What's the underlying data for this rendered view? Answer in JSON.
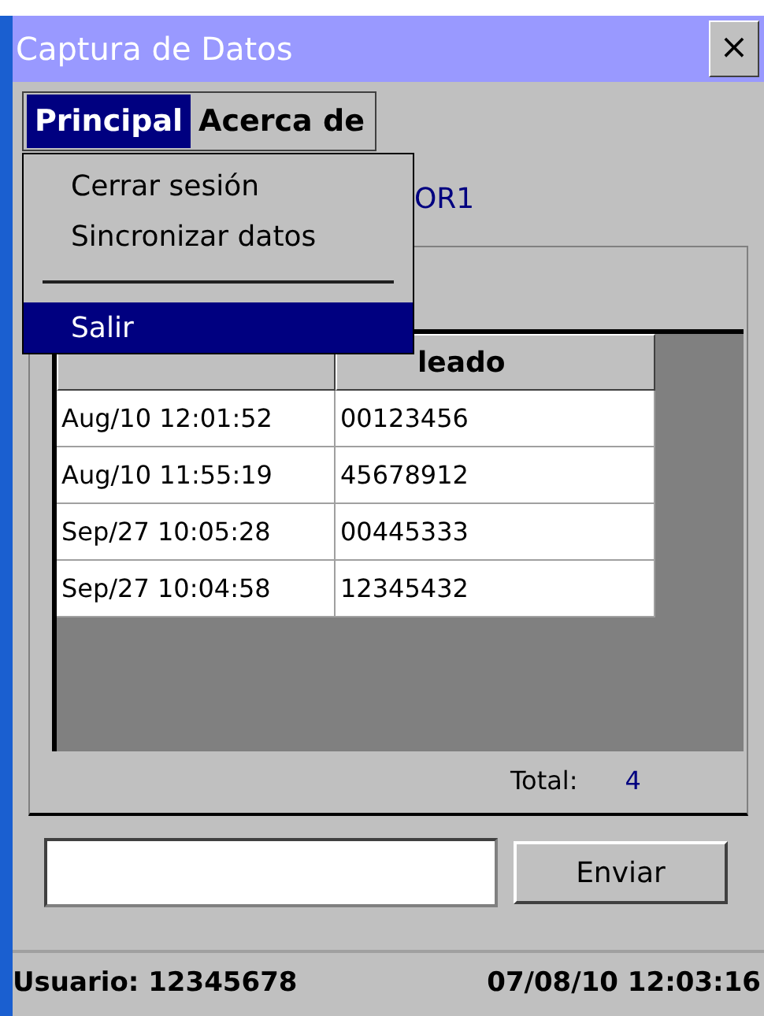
{
  "window": {
    "title": "Captura de Datos",
    "close": "×"
  },
  "menu_bar": [
    {
      "label": "Principal",
      "selected": true
    },
    {
      "label": "Acerca de",
      "selected": false
    }
  ],
  "dropdown": [
    {
      "kind": "item",
      "label": "Cerrar sesión",
      "selected": false
    },
    {
      "kind": "item",
      "label": "Sincronizar datos",
      "selected": false
    },
    {
      "kind": "separator"
    },
    {
      "kind": "item",
      "label": "Salir",
      "selected": true
    }
  ],
  "label_fragment": "OR1",
  "table": {
    "columns": [
      "",
      "leado"
    ],
    "rows": [
      [
        "Aug/10 12:01:52",
        "00123456"
      ],
      [
        "Aug/10 11:55:19",
        "45678912"
      ],
      [
        "Sep/27 10:05:28",
        "00445333"
      ],
      [
        "Sep/27 10:04:58",
        "12345432"
      ]
    ]
  },
  "total": {
    "label": "Total:",
    "value": "4"
  },
  "send_button": "Enviar",
  "status_bar": {
    "user": "Usuario: 12345678",
    "datetime": "07/08/10 12:03:16"
  }
}
